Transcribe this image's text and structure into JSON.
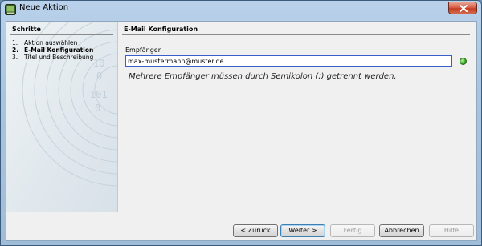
{
  "window": {
    "title": "Neue Aktion"
  },
  "steps": {
    "heading": "Schritte",
    "items": [
      {
        "num": "1.",
        "label": "Aktion auswählen",
        "active": false
      },
      {
        "num": "2.",
        "label": "E-Mail Konfiguration",
        "active": true
      },
      {
        "num": "3.",
        "label": "Titel und Beschreibung",
        "active": false
      }
    ]
  },
  "main": {
    "heading": "E-Mail Konfiguration",
    "recipient_label": "Empfänger",
    "recipient_value": "max-mustermann@muster.de",
    "hint": "Mehrere Empfänger müssen durch Semikolon (;) getrennt werden.",
    "status": "valid"
  },
  "buttons": {
    "back": "< Zurück",
    "next": "Weiter >",
    "finish": "Fertig",
    "cancel": "Abbrechen",
    "help": "Hilfe"
  },
  "colors": {
    "status_ok": "#3fae2a",
    "input_border": "#3a5fcd",
    "close_button": "#c23c22"
  }
}
